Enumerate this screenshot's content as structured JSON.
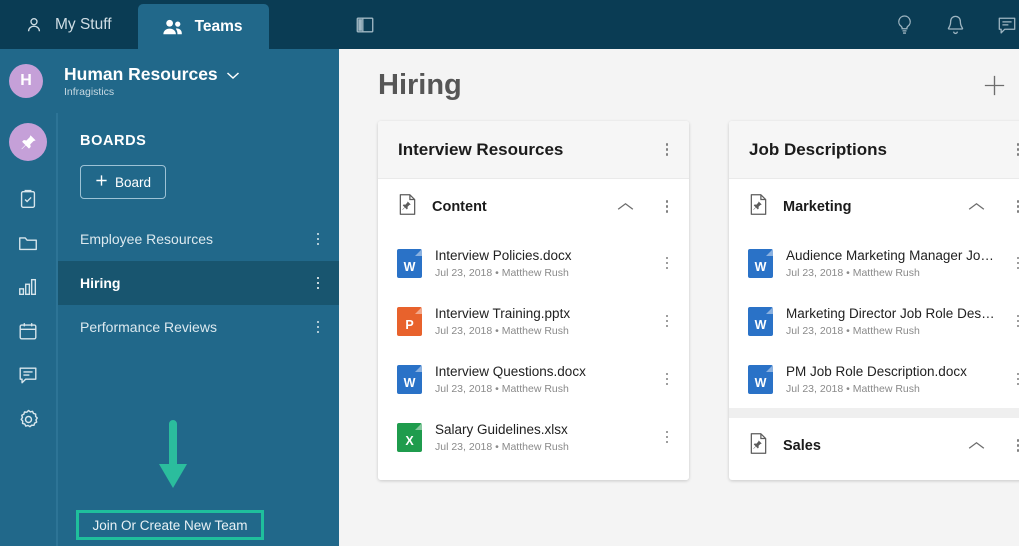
{
  "tabs": [
    {
      "label": "My Stuff",
      "icon": "person-icon",
      "active": false
    },
    {
      "label": "Teams",
      "icon": "people-icon",
      "active": true
    }
  ],
  "team": {
    "avatar_letter": "H",
    "name": "Human Resources",
    "org": "Infragistics",
    "chevron": "chevron-down-icon"
  },
  "rail": {
    "pin_icon": "pin-icon",
    "items": [
      {
        "icon": "clipboard-check-icon"
      },
      {
        "icon": "folder-icon"
      },
      {
        "icon": "bar-chart-icon"
      },
      {
        "icon": "calendar-icon"
      },
      {
        "icon": "comment-icon"
      },
      {
        "icon": "gear-icon"
      }
    ]
  },
  "boards": {
    "heading": "BOARDS",
    "add_board_label": "Board",
    "add_board_icon": "plus-icon",
    "items": [
      {
        "label": "Employee Resources",
        "selected": false
      },
      {
        "label": "Hiring",
        "selected": true
      },
      {
        "label": "Performance Reviews",
        "selected": false
      }
    ],
    "join_button_label": "Join Or Create New Team"
  },
  "annotation": {
    "arrow_icon": "down-arrow-annotation",
    "highlight_color": "#1fbf9c"
  },
  "topbar": {
    "toggle_icon": "sidebar-toggle-icon",
    "icons": [
      {
        "name": "lightbulb-icon"
      },
      {
        "name": "bell-icon"
      },
      {
        "name": "chat-icon"
      }
    ]
  },
  "page": {
    "title": "Hiring",
    "add_icon": "plus-icon"
  },
  "cards": [
    {
      "title": "Interview Resources",
      "sections": [
        {
          "name": "Content",
          "icon": "document-pin-icon",
          "collapse_icon": "chevron-up-icon",
          "files": [
            {
              "name": "Interview Policies.docx",
              "sub": "Jul 23, 2018 • Matthew Rush",
              "type": "W",
              "color": "#2a72c7"
            },
            {
              "name": "Interview Training.pptx",
              "sub": "Jul 23, 2018 • Matthew Rush",
              "type": "P",
              "color": "#e8622c"
            },
            {
              "name": "Interview Questions.docx",
              "sub": "Jul 23, 2018 • Matthew Rush",
              "type": "W",
              "color": "#2a72c7"
            },
            {
              "name": "Salary Guidelines.xlsx",
              "sub": "Jul 23, 2018 • Matthew Rush",
              "type": "X",
              "color": "#1f9c4d"
            }
          ]
        }
      ]
    },
    {
      "title": "Job Descriptions",
      "sections": [
        {
          "name": "Marketing",
          "icon": "document-pin-icon",
          "collapse_icon": "chevron-up-icon",
          "files": [
            {
              "name": "Audience Marketing Manager Job Role Description.docx",
              "sub": "Jul 23, 2018 • Matthew Rush",
              "type": "W",
              "color": "#2a72c7"
            },
            {
              "name": "Marketing Director Job Role Description.docx",
              "sub": "Jul 23, 2018 • Matthew Rush",
              "type": "W",
              "color": "#2a72c7"
            },
            {
              "name": "PM Job Role Description.docx",
              "sub": "Jul 23, 2018 • Matthew Rush",
              "type": "W",
              "color": "#2a72c7"
            }
          ]
        },
        {
          "name": "Sales",
          "icon": "document-pin-icon",
          "collapse_icon": "chevron-up-icon",
          "files": []
        }
      ]
    }
  ],
  "colors": {
    "header_dark": "#0a3c54",
    "sidebar_teal": "#21688a",
    "selected_teal": "#18556f",
    "avatar_purple": "#c5a0d8",
    "annotation_green": "#1fbf9c",
    "canvas": "#f4f4f4"
  }
}
